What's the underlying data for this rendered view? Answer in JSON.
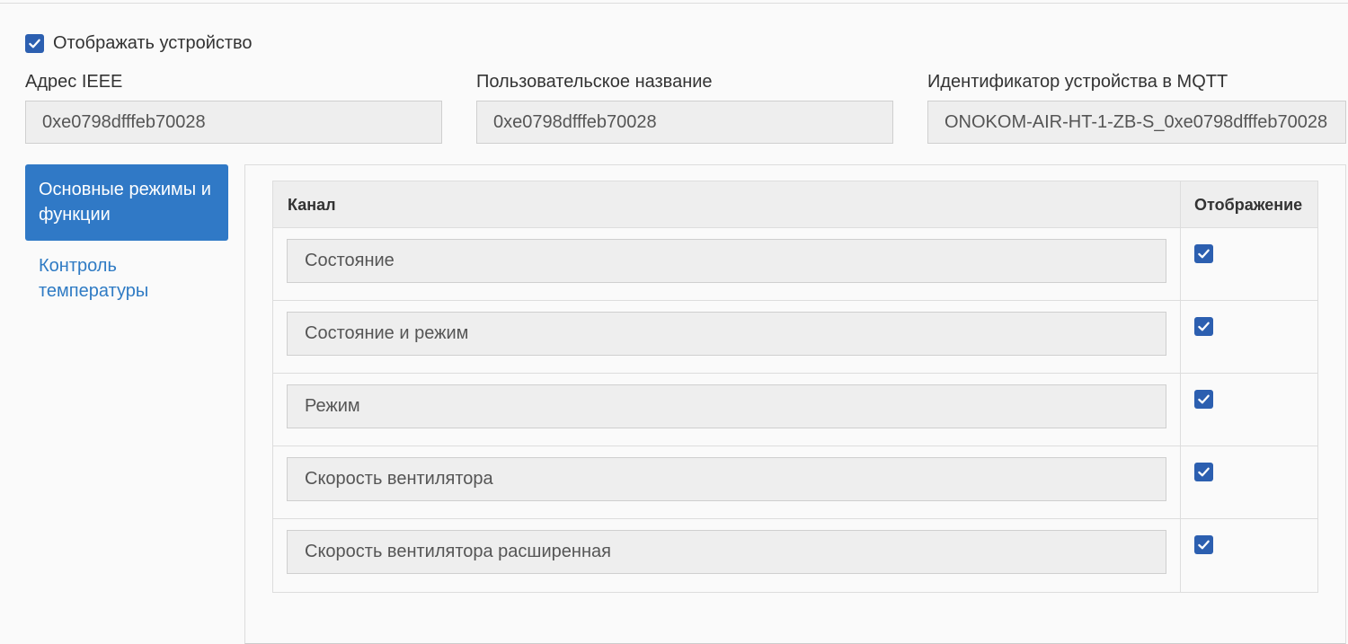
{
  "device": {
    "show_device_label": "Отображать устройство",
    "show_device_checked": true
  },
  "fields": [
    {
      "label": "Адрес IEEE",
      "value": "0xe0798dfffeb70028"
    },
    {
      "label": "Пользовательское название",
      "value": "0xe0798dfffeb70028"
    },
    {
      "label": "Идентификатор устройства в MQTT",
      "value": "ONOKOM-AIR-HT-1-ZB-S_0xe0798dfffeb70028"
    }
  ],
  "tabs": [
    {
      "label": "Основные режимы и функции",
      "active": true
    },
    {
      "label": "Контроль температуры",
      "active": false
    }
  ],
  "table": {
    "headers": {
      "channel": "Канал",
      "display": "Отображение"
    },
    "rows": [
      {
        "channel": "Состояние",
        "display": true
      },
      {
        "channel": "Состояние и режим",
        "display": true
      },
      {
        "channel": "Режим",
        "display": true
      },
      {
        "channel": "Скорость вентилятора",
        "display": true
      },
      {
        "channel": "Скорость вентилятора расширенная",
        "display": true
      }
    ]
  },
  "colors": {
    "accent": "#3079c6",
    "checkbox": "#2c5fb0",
    "link": "#2f7bc4"
  },
  "icons": {
    "checkbox": "check-icon"
  }
}
